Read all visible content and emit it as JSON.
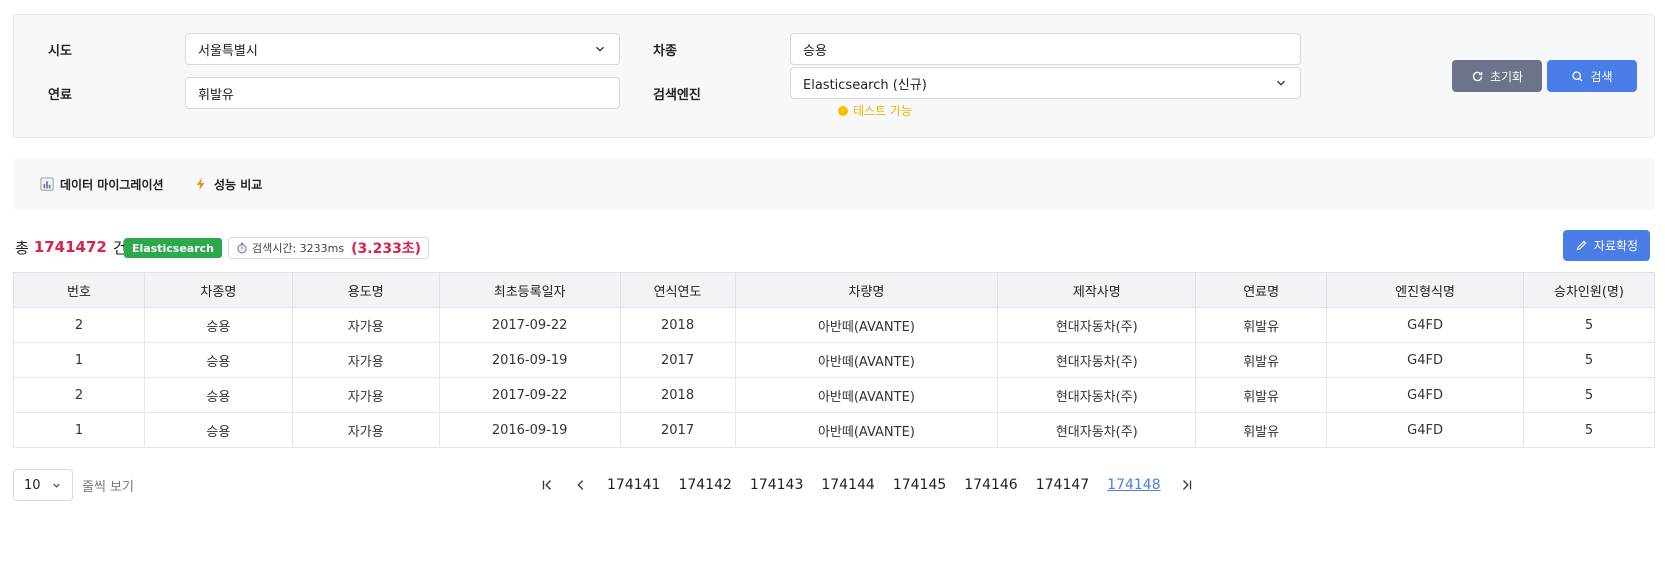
{
  "search": {
    "sido_label": "시도",
    "sido_value": "서울특별시",
    "fuel_label": "연료",
    "fuel_value": "휘발유",
    "vehicle_type_label": "차종",
    "vehicle_type_value": "승용",
    "engine_label": "검색엔진",
    "engine_value": "Elasticsearch (신규)",
    "engine_status": "테스트 가능",
    "reset_label": "초기화",
    "search_label": "검색"
  },
  "tabs": [
    {
      "label": "데이터 마이그레이션",
      "icon": "bar-chart-icon"
    },
    {
      "label": "성능 비교",
      "icon": "lightning-icon"
    }
  ],
  "summary": {
    "prefix": "총",
    "count": "1741472",
    "suffix": "건",
    "engine_badge": "Elasticsearch",
    "time_label": "검색시간: 3233ms",
    "time_seconds": "(3.233초)",
    "confirm_label": "자료확정"
  },
  "table": {
    "headers": [
      "번호",
      "차종명",
      "용도명",
      "최초등록일자",
      "연식연도",
      "차량명",
      "제작사명",
      "연료명",
      "엔진형식명",
      "승차인원(명)"
    ],
    "rows": [
      [
        "2",
        "승용",
        "자가용",
        "2017-09-22",
        "2018",
        "아반떼(AVANTE)",
        "현대자동차(주)",
        "휘발유",
        "G4FD",
        "5"
      ],
      [
        "1",
        "승용",
        "자가용",
        "2016-09-19",
        "2017",
        "아반떼(AVANTE)",
        "현대자동차(주)",
        "휘발유",
        "G4FD",
        "5"
      ],
      [
        "2",
        "승용",
        "자가용",
        "2017-09-22",
        "2018",
        "아반떼(AVANTE)",
        "현대자동차(주)",
        "휘발유",
        "G4FD",
        "5"
      ],
      [
        "1",
        "승용",
        "자가용",
        "2016-09-19",
        "2017",
        "아반떼(AVANTE)",
        "현대자동차(주)",
        "휘발유",
        "G4FD",
        "5"
      ]
    ]
  },
  "pagination": {
    "page_size": "10",
    "page_size_label": "줄씩 보기",
    "pages": [
      "174141",
      "174142",
      "174143",
      "174144",
      "174145",
      "174146",
      "174147",
      "174148"
    ],
    "current": "174148"
  },
  "colors": {
    "primary": "#4a7de8",
    "secondary": "#6c7489",
    "success": "#2ea84c",
    "danger": "#d9234a",
    "warning": "#f5c000"
  }
}
